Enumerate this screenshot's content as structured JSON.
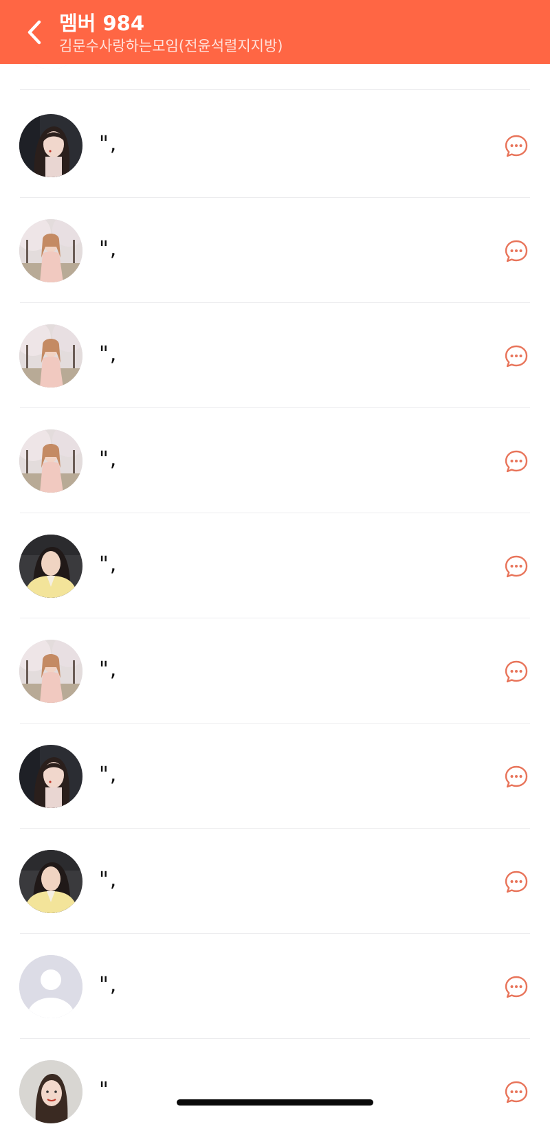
{
  "colors": {
    "accent": "#FF6644",
    "chat_icon": "#E8745A"
  },
  "header": {
    "back_icon": "chevron-left-icon",
    "title": "멤버 984",
    "subtitle": "김문수사랑하는모임(전윤석렬지지방)"
  },
  "members": [
    {
      "name": "\",",
      "avatar": "default-avatar"
    },
    {
      "name": "\",",
      "avatar": "photo-dark-hair"
    },
    {
      "name": "\",",
      "avatar": "photo-cherry-blossom"
    },
    {
      "name": "\",",
      "avatar": "photo-cherry-blossom"
    },
    {
      "name": "\",",
      "avatar": "photo-cherry-blossom"
    },
    {
      "name": "\",",
      "avatar": "photo-yellow-jacket"
    },
    {
      "name": "\",",
      "avatar": "photo-cherry-blossom"
    },
    {
      "name": "\",",
      "avatar": "photo-dark-hair"
    },
    {
      "name": "\",",
      "avatar": "photo-yellow-jacket"
    },
    {
      "name": "\",",
      "avatar": "default-avatar"
    },
    {
      "name": "\"",
      "avatar": "photo-portrait"
    }
  ],
  "chat_icon": "chat-bubble-icon"
}
